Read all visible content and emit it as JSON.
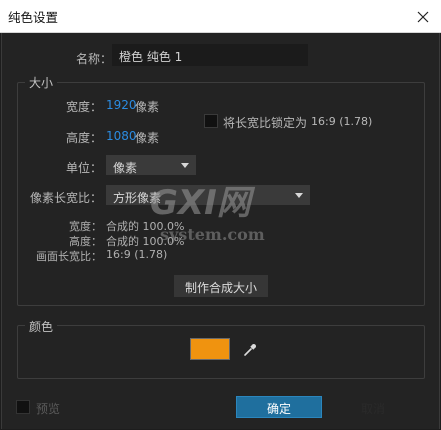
{
  "window": {
    "title": "纯色设置"
  },
  "name": {
    "label": "名称：",
    "value": "橙色 纯色 1"
  },
  "size_group": {
    "title": "大小",
    "width_label": "宽度：",
    "width_value": "1920",
    "width_unit": "像素",
    "height_label": "高度：",
    "height_value": "1080",
    "height_unit": "像素",
    "lock_label": "将长宽比锁定为",
    "lock_ratio": "16:9 (1.78)",
    "lock_checked": false,
    "unit_label": "单位：",
    "unit_value": "像素",
    "par_label": "像素长宽比：",
    "par_value": "方形像素",
    "info_width_label": "宽度：",
    "info_width_value": "合成的 100.0%",
    "info_height_label": "高度：",
    "info_height_value": "合成的 100.0%",
    "info_frame_label": "画面长宽比：",
    "info_frame_value": "16:9 (1.78)",
    "make_comp_size_button": "制作合成大小"
  },
  "color_group": {
    "title": "颜色",
    "swatch_color": "#f0930f"
  },
  "footer": {
    "preview_label": "预览",
    "preview_checked": false,
    "ok_button": "确定",
    "cancel_button": "取消"
  },
  "watermark": {
    "logo_text": "GXI网",
    "site_text": "system.com"
  },
  "colors": {
    "background": "#232323",
    "accent_blue": "#2b8be0",
    "ok_button": "#1f6f9e"
  },
  "icons": {
    "close": "close-icon",
    "eyedropper": "eyedropper-icon",
    "dropdown": "chevron-down-icon"
  }
}
